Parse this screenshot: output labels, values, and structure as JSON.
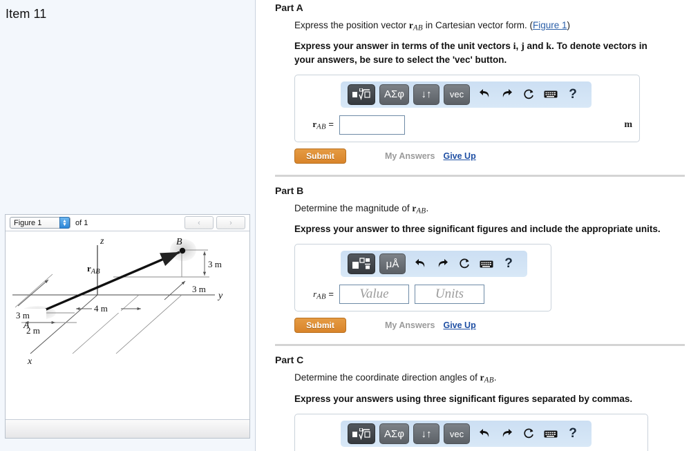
{
  "sidebar": {
    "item_title": "Item 11",
    "figure_widget": {
      "select_value": "Figure 1",
      "of_label": "of 1",
      "prev_icon": "‹",
      "next_icon": "›"
    }
  },
  "figure": {
    "caption_vector": "r",
    "caption_sub": "AB",
    "axis_z": "z",
    "axis_y": "y",
    "axis_x": "x",
    "point_a": "A",
    "point_b": "B",
    "dim_3m_left": "3 m",
    "dim_2m": "2 m",
    "dim_4m": "4 m",
    "dim_3m_mid": "3 m",
    "dim_3m_right": "3 m"
  },
  "parts": [
    {
      "heading": "Part A",
      "prompt_pre": "Express the position vector ",
      "prompt_var": "r",
      "prompt_sub": "AB",
      "prompt_post": " in Cartesian vector form. (",
      "link_text": "Figure 1",
      "prompt_end": ")",
      "instruction_1": "Express your answer in terms of the unit vectors ",
      "unit_i": "i",
      "instruction_sep1": ", ",
      "unit_j": "j",
      "instruction_sep2": " and ",
      "unit_k": "k",
      "instruction_2": ". To denote vectors in your answers, be sure to select the 'vec' button.",
      "toolbar": {
        "buttons": [
          "√",
          "ΑΣφ",
          "↓↑",
          "vec"
        ],
        "sqrt_label": "sqrt-template",
        "greek_label": "ΑΣφ",
        "arrows_label": "↓↑",
        "vec_label": "vec",
        "undo": "↩",
        "redo": "↪",
        "reset": "↻",
        "keyboard": "⌨",
        "help": "?"
      },
      "answer_label_var": "r",
      "answer_label_sub": "AB",
      "answer_label_eq": " =",
      "answer_value": "",
      "unit_suffix": "m",
      "submit_label": "Submit",
      "my_answers_label": "My Answers",
      "give_up_label": "Give Up"
    },
    {
      "heading": "Part B",
      "prompt_pre": "Determine the magnitude of ",
      "prompt_var": "r",
      "prompt_sub": "AB",
      "prompt_post": ".",
      "instruction": "Express your answer to three significant figures and include the appropriate units.",
      "toolbar": {
        "template_label": "template",
        "units_label": "μÅ",
        "undo": "↩",
        "redo": "↪",
        "reset": "↻",
        "keyboard": "⌨",
        "help": "?"
      },
      "answer_label_var": "r",
      "answer_label_sub": "AB",
      "answer_label_eq": " =",
      "value_placeholder": "Value",
      "units_placeholder": "Units",
      "submit_label": "Submit",
      "my_answers_label": "My Answers",
      "give_up_label": "Give Up"
    },
    {
      "heading": "Part C",
      "prompt_pre": "Determine the coordinate direction angles of ",
      "prompt_var": "r",
      "prompt_sub": "AB",
      "prompt_post": ".",
      "instruction": "Express your answers using three significant figures separated by commas.",
      "toolbar": {
        "sqrt_label": "sqrt-template",
        "greek_label": "ΑΣφ",
        "arrows_label": "↓↑",
        "vec_label": "vec",
        "undo": "↩",
        "redo": "↪",
        "reset": "↻",
        "keyboard": "⌨",
        "help": "?"
      }
    }
  ],
  "colors": {
    "sidebar_bg": "#f3f7fc",
    "toolbar_bg": "#d2e3f5",
    "submit_orange": "#d9842a",
    "link_blue": "#1f4fa3",
    "input_border": "#6d8aa6"
  }
}
